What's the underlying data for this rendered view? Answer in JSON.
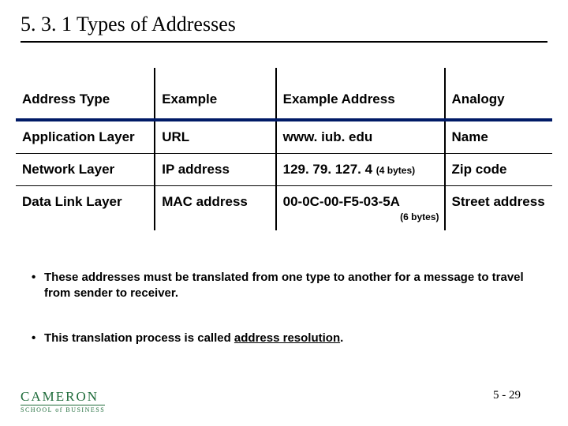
{
  "title": "5. 3. 1  Types of Addresses",
  "table": {
    "headers": {
      "c1": "Address Type",
      "c2": "Example",
      "c3": "Example Address",
      "c4": "Analogy"
    },
    "rows": [
      {
        "c1": "Application Layer",
        "c2": "URL",
        "c3": "www. iub. edu",
        "c3_note": "",
        "c4": "Name"
      },
      {
        "c1": "Network Layer",
        "c2": "IP address",
        "c3": "129. 79. 127. 4",
        "c3_note": "(4 bytes)",
        "c4": "Zip code"
      },
      {
        "c1": "Data Link Layer",
        "c2": "MAC address",
        "c3": "00-0C-00-F5-03-5A",
        "c3_note": "(6 bytes)",
        "c4": "Street address"
      }
    ]
  },
  "bullets": [
    "These addresses must be translated from one type to another for a message to travel from sender to receiver.",
    {
      "pre": "This translation process is called ",
      "u": "address resolution",
      "post": "."
    }
  ],
  "logo": {
    "line1": "CAMERON",
    "line2": "SCHOOL of BUSINESS"
  },
  "pagenum": "5 - 29"
}
